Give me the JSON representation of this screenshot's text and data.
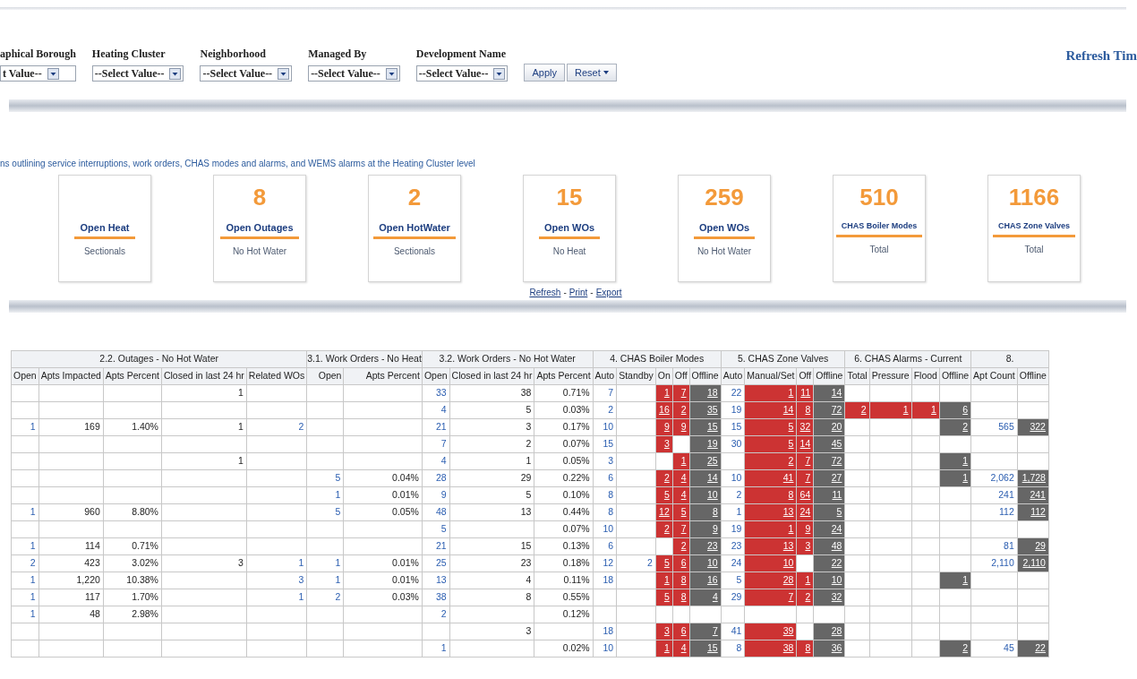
{
  "filters": [
    {
      "label": "aphical Borough",
      "value": "t Value--"
    },
    {
      "label": "Heating Cluster",
      "value": "--Select Value--"
    },
    {
      "label": "Neighborhood",
      "value": "--Select Value--"
    },
    {
      "label": "Managed By",
      "value": "--Select Value--"
    },
    {
      "label": "Development Name",
      "value": "--Select Value--"
    }
  ],
  "apply_button": "Apply",
  "reset_button": "Reset",
  "refresh_time_label": "Refresh Tim",
  "description": "ns outlining service interruptions, work orders, CHAS modes and alarms, and WEMS alarms at the Heating Cluster level",
  "kpis": [
    {
      "title": "Open Heat",
      "subtitle": "Sectionals",
      "compact": false
    },
    {
      "value": "8",
      "title": "Open Outages",
      "subtitle": "No Hot Water",
      "compact": false
    },
    {
      "value": "2",
      "title": "Open HotWater",
      "subtitle": "Sectionals",
      "compact": false
    },
    {
      "value": "15",
      "title": "Open WOs",
      "subtitle": "No Heat",
      "compact": false
    },
    {
      "value": "259",
      "title": "Open WOs",
      "subtitle": "No Hot Water",
      "compact": false
    },
    {
      "value": "510",
      "title": "CHAS Boiler Modes",
      "subtitle": "Total",
      "compact": true
    },
    {
      "value": "1166",
      "title": "CHAS Zone Valves",
      "subtitle": "Total",
      "compact": true
    }
  ],
  "links": [
    {
      "text": "Refresh"
    },
    {
      "separator": "-",
      "text": "Print"
    },
    {
      "separator": "-",
      "text": "Export"
    }
  ],
  "table": {
    "groups": [
      {
        "title": "2.2. Outages - No Hot Water",
        "columns": [
          {
            "title": "Open",
            "kind": "link"
          },
          {
            "title": "Apts Impacted",
            "kind": "plain"
          },
          {
            "title": "Apts Percent",
            "kind": "plain"
          },
          {
            "title": "Closed in last 24 hr",
            "kind": "plain"
          },
          {
            "title": "Related WOs",
            "kind": "link"
          }
        ]
      },
      {
        "title": "3.1. Work Orders - No Heat",
        "columns": [
          {
            "title": "Open",
            "kind": "link"
          },
          {
            "title": "Apts Percent",
            "kind": "plain"
          }
        ]
      },
      {
        "title": "3.2. Work Orders - No Hot Water",
        "columns": [
          {
            "title": "Open",
            "kind": "link"
          },
          {
            "title": "Closed in last 24 hr",
            "kind": "plain"
          },
          {
            "title": "Apts Percent",
            "kind": "plain"
          }
        ]
      },
      {
        "title": "4. CHAS Boiler Modes",
        "columns": [
          {
            "title": "Auto",
            "kind": "link"
          },
          {
            "title": "Standby",
            "kind": "link"
          },
          {
            "title": "On",
            "kind": "alert"
          },
          {
            "title": "Off",
            "kind": "alert"
          },
          {
            "title": "Offline",
            "kind": "offline"
          }
        ]
      },
      {
        "title": "5. CHAS Zone Valves",
        "columns": [
          {
            "title": "Auto",
            "kind": "link"
          },
          {
            "title": "Manual/Set",
            "kind": "alert"
          },
          {
            "title": "Off",
            "kind": "alert"
          },
          {
            "title": "Offline",
            "kind": "offline"
          }
        ]
      },
      {
        "title": "6. CHAS Alarms - Current",
        "columns": [
          {
            "title": "Total",
            "kind": "alert"
          },
          {
            "title": "Pressure",
            "kind": "alert"
          },
          {
            "title": "Flood",
            "kind": "alert"
          },
          {
            "title": "Offline",
            "kind": "offline"
          }
        ]
      },
      {
        "title": "8.",
        "columns": [
          {
            "title": "Apt Count",
            "kind": "link"
          },
          {
            "title": "Offline",
            "kind": "offline"
          }
        ]
      }
    ],
    "rows": [
      [
        null,
        null,
        null,
        "1",
        null,
        null,
        null,
        "33",
        "38",
        "0.71%",
        "7",
        null,
        "1",
        "7",
        "18",
        "22",
        "1",
        "11",
        "14",
        null,
        null,
        null,
        null,
        null,
        null
      ],
      [
        null,
        null,
        null,
        null,
        null,
        null,
        null,
        "4",
        "5",
        "0.03%",
        "2",
        null,
        "16",
        "2",
        "35",
        "19",
        "14",
        "8",
        "72",
        "2",
        "1",
        "1",
        "6",
        null,
        null
      ],
      [
        "1",
        "169",
        "1.40%",
        "1",
        "2",
        null,
        null,
        "21",
        "3",
        "0.17%",
        "10",
        null,
        "9",
        "9",
        "15",
        "15",
        "5",
        "32",
        "20",
        null,
        null,
        null,
        "2",
        "565",
        "322"
      ],
      [
        null,
        null,
        null,
        null,
        null,
        null,
        null,
        "7",
        "2",
        "0.07%",
        "15",
        null,
        "3",
        null,
        "19",
        "30",
        "5",
        "14",
        "45",
        null,
        null,
        null,
        null,
        null,
        null
      ],
      [
        null,
        null,
        null,
        "1",
        null,
        null,
        null,
        "4",
        "1",
        "0.05%",
        "3",
        null,
        null,
        "1",
        "25",
        null,
        "2",
        "7",
        "72",
        null,
        null,
        null,
        "1",
        null,
        null
      ],
      [
        null,
        null,
        null,
        null,
        null,
        "5",
        "0.04%",
        "28",
        "29",
        "0.22%",
        "6",
        null,
        "2",
        "4",
        "14",
        "10",
        "41",
        "7",
        "27",
        null,
        null,
        null,
        "1",
        "2,062",
        "1,728"
      ],
      [
        null,
        null,
        null,
        null,
        null,
        "1",
        "0.01%",
        "9",
        "5",
        "0.10%",
        "8",
        null,
        "5",
        "4",
        "10",
        "2",
        "8",
        "64",
        "11",
        null,
        null,
        null,
        null,
        "241",
        "241"
      ],
      [
        "1",
        "960",
        "8.80%",
        null,
        null,
        "5",
        "0.05%",
        "48",
        "13",
        "0.44%",
        "8",
        null,
        "12",
        "5",
        "8",
        "1",
        "13",
        "24",
        "5",
        null,
        null,
        null,
        null,
        "112",
        "112"
      ],
      [
        null,
        null,
        null,
        null,
        null,
        null,
        null,
        "5",
        null,
        "0.07%",
        "10",
        null,
        "2",
        "7",
        "9",
        "19",
        "1",
        "9",
        "24",
        null,
        null,
        null,
        null,
        null,
        null
      ],
      [
        "1",
        "114",
        "0.71%",
        null,
        null,
        null,
        null,
        "21",
        "15",
        "0.13%",
        "6",
        null,
        null,
        "2",
        "23",
        "23",
        "13",
        "3",
        "48",
        null,
        null,
        null,
        null,
        "81",
        "29"
      ],
      [
        "2",
        "423",
        "3.02%",
        "3",
        "1",
        "1",
        "0.01%",
        "25",
        "23",
        "0.18%",
        "12",
        "2",
        "5",
        "6",
        "10",
        "24",
        "10",
        null,
        "22",
        null,
        null,
        null,
        null,
        "2,110",
        "2,110"
      ],
      [
        "1",
        "1,220",
        "10.38%",
        null,
        "3",
        "1",
        "0.01%",
        "13",
        "4",
        "0.11%",
        "18",
        null,
        "1",
        "8",
        "16",
        "5",
        "28",
        "1",
        "10",
        null,
        null,
        null,
        "1",
        null,
        null
      ],
      [
        "1",
        "117",
        "1.70%",
        null,
        "1",
        "2",
        "0.03%",
        "38",
        "8",
        "0.55%",
        null,
        null,
        "5",
        "8",
        "4",
        "29",
        "7",
        "2",
        "32",
        null,
        null,
        null,
        null,
        null,
        null
      ],
      [
        "1",
        "48",
        "2.98%",
        null,
        null,
        null,
        null,
        "2",
        null,
        "0.12%",
        null,
        null,
        null,
        null,
        null,
        null,
        null,
        null,
        null,
        null,
        null,
        null,
        null,
        null,
        null
      ],
      [
        null,
        null,
        null,
        null,
        null,
        null,
        null,
        null,
        "3",
        null,
        "18",
        null,
        "3",
        "6",
        "7",
        "41",
        "39",
        null,
        "28",
        null,
        null,
        null,
        null,
        null,
        null
      ],
      [
        null,
        null,
        null,
        null,
        null,
        null,
        null,
        "1",
        null,
        "0.02%",
        "10",
        null,
        "1",
        "4",
        "15",
        "8",
        "38",
        "8",
        "36",
        null,
        null,
        null,
        "2",
        "45",
        "22"
      ]
    ]
  }
}
